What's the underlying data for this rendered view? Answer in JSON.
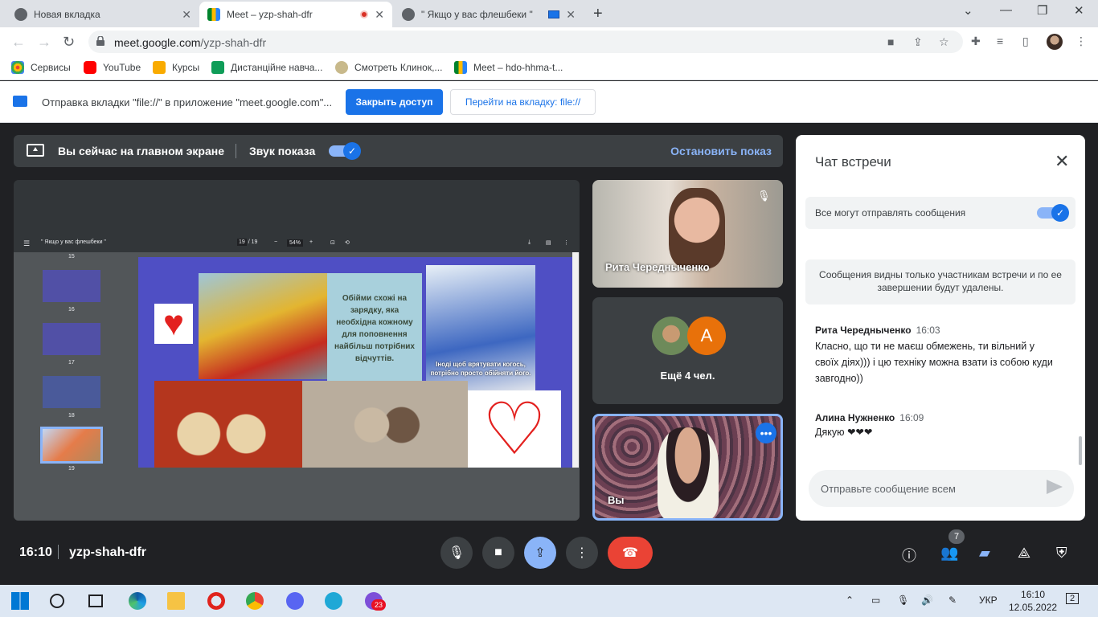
{
  "browser": {
    "tabs": [
      {
        "title": "Новая вкладка"
      },
      {
        "title": "Meet – yzp-shah-dfr"
      },
      {
        "title": "\" Якщо у вас флешбеки \""
      }
    ],
    "url_host": "meet.google.com",
    "url_path": "/yzp-shah-dfr",
    "bookmarks": [
      {
        "label": "Сервисы"
      },
      {
        "label": "YouTube"
      },
      {
        "label": "Курсы"
      },
      {
        "label": "Дистанційне навча..."
      },
      {
        "label": "Смотреть Клинок,..."
      },
      {
        "label": "Meet – hdo-hhma-t..."
      }
    ]
  },
  "infobar": {
    "message": "Отправка вкладки \"file://\" в приложение \"meet.google.com\"...",
    "primary_button": "Закрыть доступ",
    "secondary_button": "Перейти на вкладку: file://"
  },
  "sharebar": {
    "status": "Вы сейчас на главном экране",
    "sound_label": "Звук показа",
    "sound_on": true,
    "stop_label": "Остановить показ"
  },
  "presentation": {
    "pdf_title": "\" Якщо у вас флешбеки \"",
    "page_current": "19",
    "page_sep": "/",
    "page_total": "19",
    "zoom": "54%",
    "thumb_numbers": [
      "15",
      "16",
      "17",
      "18",
      "19"
    ],
    "slide_text_1": "Обійми схожі на зарядку, яка необхідна кожному для поповнення найбільш потрібних відчуттів.",
    "slide_text_2": "Іноді щоб врятувати когось, потрібно просто обійняти його."
  },
  "participants": {
    "tile1_name": "Рита Чередныченко",
    "tile2_avatar_letter": "A",
    "tile2_more": "Ещё 4 чел.",
    "tile3_name": "Вы"
  },
  "chat": {
    "title": "Чат встречи",
    "permission_label": "Все могут отправлять сообщения",
    "permission_on": true,
    "notice": "Сообщения видны только участникам встречи и по ее завершении будут удалены.",
    "messages": [
      {
        "author": "Рита Чередныченко",
        "time": "16:03",
        "text": "Класно, що ти не маєш обмежень, ти вільний у своїх діях))) і цю техніку можна взати із собою куди завгодно))"
      },
      {
        "author": "Алина Нужненко",
        "time": "16:09",
        "text": "Дякую ❤❤❤"
      }
    ],
    "input_placeholder": "Отправьте сообщение всем"
  },
  "meeting": {
    "time": "16:10",
    "code": "yzp-shah-dfr",
    "participant_count": "7"
  },
  "taskbar": {
    "discord_badge": "23",
    "language": "УКР",
    "clock_time": "16:10",
    "clock_date": "12.05.2022",
    "notifications": "2"
  },
  "colors": {
    "meet_bg": "#202124",
    "accent": "#1a73e8",
    "end_call": "#ea4335",
    "slide_bg": "#4f4fc4"
  }
}
